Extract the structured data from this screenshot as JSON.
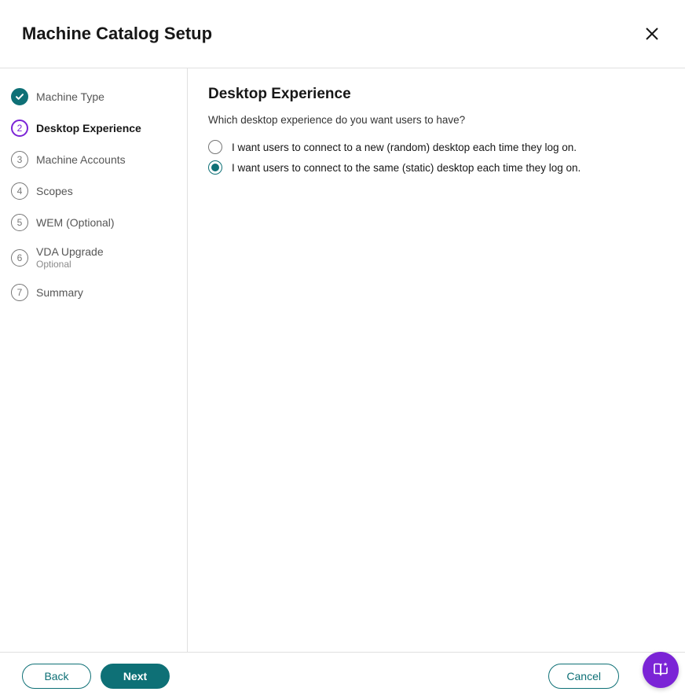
{
  "header": {
    "title": "Machine Catalog Setup"
  },
  "steps": [
    {
      "num": "1",
      "label": "Machine Type",
      "sub": "",
      "state": "completed"
    },
    {
      "num": "2",
      "label": "Desktop Experience",
      "sub": "",
      "state": "active"
    },
    {
      "num": "3",
      "label": "Machine Accounts",
      "sub": "",
      "state": "upcoming"
    },
    {
      "num": "4",
      "label": "Scopes",
      "sub": "",
      "state": "upcoming"
    },
    {
      "num": "5",
      "label": "WEM (Optional)",
      "sub": "",
      "state": "upcoming"
    },
    {
      "num": "6",
      "label": "VDA Upgrade",
      "sub": "Optional",
      "state": "upcoming"
    },
    {
      "num": "7",
      "label": "Summary",
      "sub": "",
      "state": "upcoming"
    }
  ],
  "main": {
    "page_title": "Desktop Experience",
    "question": "Which desktop experience do you want users to have?",
    "options": [
      {
        "label": "I want users to connect to a new (random) desktop each time they log on.",
        "selected": false
      },
      {
        "label": "I want users to connect to the same (static) desktop each time they log on.",
        "selected": true
      }
    ]
  },
  "footer": {
    "back": "Back",
    "next": "Next",
    "cancel": "Cancel"
  }
}
